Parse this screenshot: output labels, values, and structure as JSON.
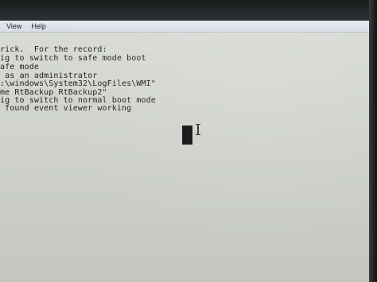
{
  "menubar": {
    "items": [
      "View",
      "Help"
    ]
  },
  "document": {
    "lines": [
      "rick.  For the record:",
      "ig to switch to safe mode boot",
      "afe mode",
      " as an administrator",
      ":\\windows\\System32\\LogFiles\\WMI\"",
      "me RtBackup RtBackup2\"",
      "ig to switch to normal boot mode",
      " found event viewer working"
    ]
  },
  "cursor": {
    "block_label": "",
    "pointer": "i-beam-icon"
  },
  "colors": {
    "background": "#cfd2cd",
    "text": "#1f1f1f",
    "menubar": "#dfe4ec",
    "bezel": "#1a1c1d"
  }
}
